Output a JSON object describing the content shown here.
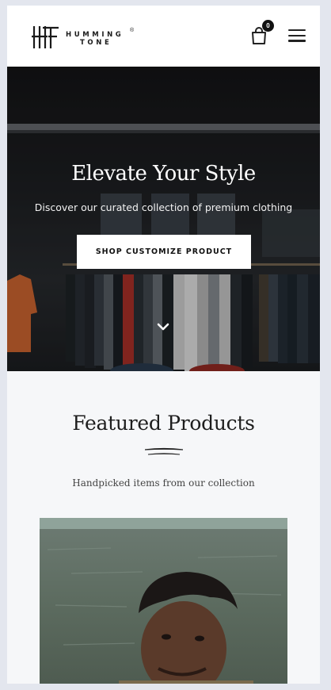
{
  "header": {
    "brand_line1": "HUMMING",
    "brand_line2": "TONE",
    "brand_reg": "®",
    "cart_count": "0",
    "cart_icon": "shopping-bag-icon",
    "menu_icon": "hamburger-menu-icon"
  },
  "hero": {
    "title": "Elevate Your Style",
    "subtitle": "Discover our curated collection of premium clothing",
    "cta_label": "SHOP CUSTOMIZE PRODUCT",
    "scroll_icon": "chevron-down-icon"
  },
  "featured": {
    "title": "Featured Products",
    "subtitle": "Handpicked items from our collection"
  },
  "colors": {
    "page_bg": "#f6f7f9",
    "header_bg": "#ffffff",
    "button_bg": "#ffffff",
    "text_dark": "#1e1e1e"
  }
}
